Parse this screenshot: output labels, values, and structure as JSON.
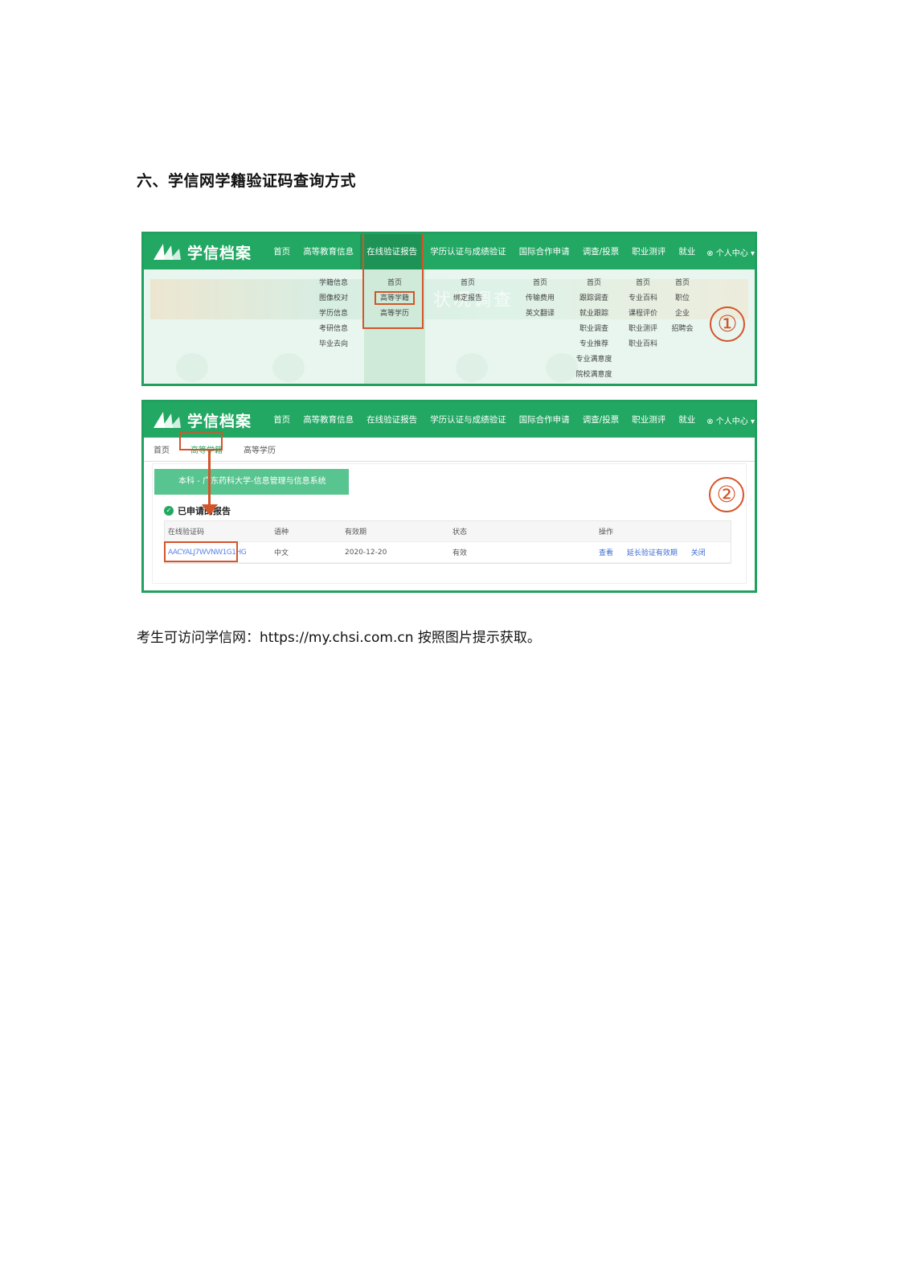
{
  "heading": "六、学信网学籍验证码查询方式",
  "footer": "考生可访问学信网：https://my.chsi.com.cn 按照图片提示获取。",
  "colors": {
    "brand_green": "#22a863",
    "highlight": "#d4542a",
    "link_blue": "#3a6bd6"
  },
  "site": {
    "logo_text": "学信档案",
    "nav": [
      "首页",
      "高等教育信息",
      "在线验证报告",
      "学历认证与成绩验证",
      "国际合作申请",
      "调查/投票",
      "职业测评",
      "就业"
    ],
    "user_center": "⊗ 个人中心 ▾"
  },
  "screenshot1": {
    "badge": "①",
    "watermark": "状况调查",
    "dropdown_columns": [
      [
        "学籍信息",
        "图像校对",
        "学历信息",
        "考研信息",
        "毕业去向"
      ],
      [
        "首页",
        "高等学籍",
        "高等学历"
      ],
      [
        "首页",
        "绑定报告"
      ],
      [
        "首页",
        "传输费用",
        "英文翻译"
      ],
      [
        "首页",
        "跟踪调查",
        "就业跟踪",
        "职业调查",
        "专业推荐",
        "专业满意度",
        "院校满意度"
      ],
      [
        "首页",
        "专业百科",
        "课程评价",
        "职业测评",
        "职业百科"
      ],
      [
        "首页",
        "职位",
        "企业",
        "招聘会"
      ]
    ]
  },
  "screenshot2": {
    "badge": "②",
    "subnav": [
      "首页",
      "高等学籍",
      "高等学历"
    ],
    "system_banner": "本科 - 广东药科大学-信息管理与信息系统",
    "applied_title": "已申请的报告",
    "table": {
      "headers": [
        "在线验证码",
        "语种",
        "有效期",
        "状态",
        "操作"
      ],
      "row": {
        "code": "AACYALJ7WVNW1G1HG",
        "language": "中文",
        "expiry": "2020-12-20",
        "status": "有效"
      },
      "actions": [
        "查看",
        "延长验证有效期",
        "关闭"
      ]
    }
  }
}
